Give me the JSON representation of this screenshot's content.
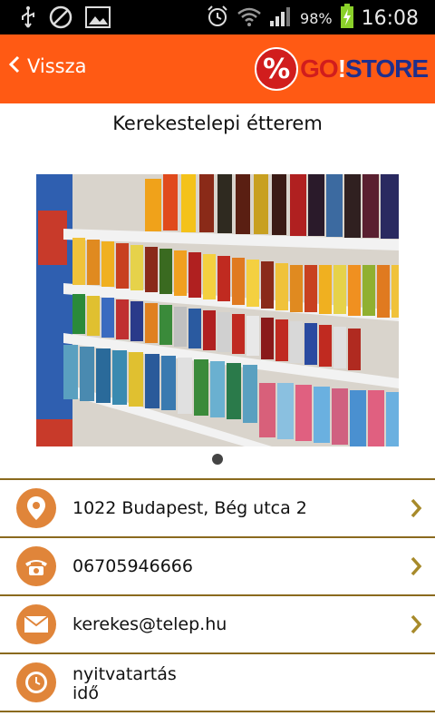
{
  "status": {
    "battery": "98%",
    "time": "16:08",
    "icons": [
      "usb-icon",
      "blocked-icon",
      "image-icon",
      "alarm-icon",
      "wifi-icon",
      "signal-icon",
      "battery-charging-icon"
    ]
  },
  "header": {
    "back_label": "Vissza",
    "logo": {
      "symbol": "%",
      "part1": "GO",
      "part2": "!",
      "part3": "STORE"
    },
    "bg_color": "#ff5a14"
  },
  "store": {
    "name": "Kerekestelepi étterem"
  },
  "carousel": {
    "pages": 1,
    "current": 1
  },
  "info": [
    {
      "icon": "location-pin-icon",
      "label": "1022 Budapest, Bég utca 2"
    },
    {
      "icon": "phone-icon",
      "label": "06705946666"
    },
    {
      "icon": "email-icon",
      "label": "kerekes@telep.hu"
    },
    {
      "icon": "clock-icon",
      "line1": "nyitvatartás",
      "line2": "idő"
    }
  ],
  "colors": {
    "accent": "#e0853a",
    "divider": "#8a6a1e"
  }
}
